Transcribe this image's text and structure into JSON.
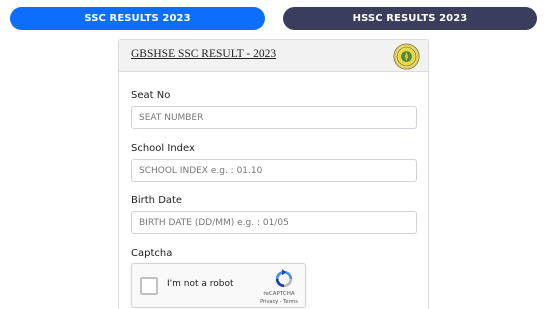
{
  "tabs": {
    "ssc": "SSC RESULTS 2023",
    "hssc": "HSSC RESULTS 2023"
  },
  "form": {
    "title": "GBSHSE SSC RESULT - 2023",
    "seat_no": {
      "label": "Seat No",
      "placeholder": "SEAT NUMBER"
    },
    "school_index": {
      "label": "School Index",
      "placeholder": "SCHOOL INDEX e.g. : 01.10"
    },
    "birth_date": {
      "label": "Birth Date",
      "placeholder": "BIRTH DATE (DD/MM) e.g. : 01/05"
    },
    "captcha_label": "Captcha"
  },
  "recaptcha": {
    "checkbox_text": "I'm not a robot",
    "brand": "reCAPTCHA",
    "privacy": "Privacy",
    "terms": "Terms",
    "separator": " - "
  },
  "colors": {
    "ssc_tab": "#0d6efd",
    "hssc_tab": "#3a3d5c"
  }
}
